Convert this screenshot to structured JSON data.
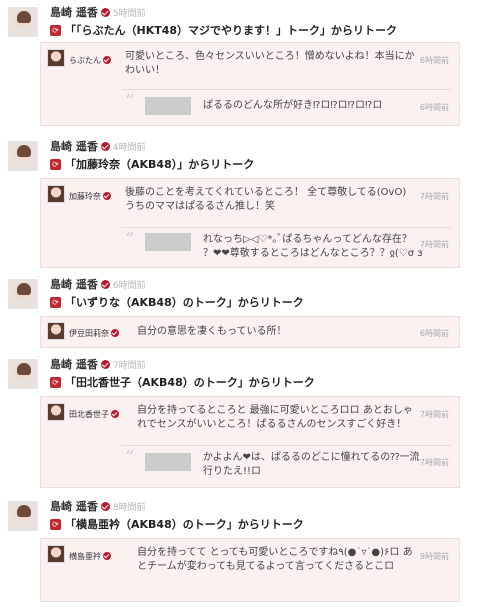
{
  "posts": [
    {
      "author": "島崎 遥香",
      "time": "5時間前",
      "retalk_title": "「「らぶたん（HKT48）マジでやります！」トーク」からリトーク",
      "talk_name": "らぶたん",
      "talk_text_1": "可愛いところ、色々センスいいところ！憎めないよね！本当にか",
      "talk_text_2": "わいい！",
      "talk_time": "6時間前",
      "quote_text": "ぱるるのどんな所が好き⁉︎ロ⁉︎ロ⁉︎ロ⁉︎ロ",
      "quote_time": "6時間前"
    },
    {
      "author": "島崎 遥香",
      "time": "4時間前",
      "retalk_title": "「加藤玲奈（AKB48）」からリトーク",
      "talk_name": "加藤玲奈",
      "talk_text_1": "後藤のことを考えてくれているところ！ 全て尊敬してる(OvO)",
      "talk_text_2": "うちのママはぱるるさん推し！笑",
      "talk_time": "7時間前",
      "quote_text_1": "れなっち▷◁♡*｡ﾟぱるちゃんってどんな存在？",
      "quote_text_2": "？❤❤尊敬するところはどんなところ？？ჲ(♡σ з",
      "quote_time": "7時間前"
    },
    {
      "author": "島崎 遥香",
      "time": "6時間前",
      "retalk_title": "「いずりな（AKB48）のトーク」からリトーク",
      "talk_name": "伊豆田莉奈",
      "talk_text": "自分の意思を凄くもっている所！",
      "talk_time": "6時間前"
    },
    {
      "author": "島崎 遥香",
      "time": "7時間前",
      "retalk_title": "「田北香世子（AKB48）のトーク」からリトーク",
      "talk_name": "田北香世子",
      "talk_text_1": "自分を持ってるところと 最強に可愛いところロロ あとおしゃ",
      "talk_text_2": "れでセンスがいいところ！ぱるるさんのセンスすごく好き！",
      "talk_time": "7時間前",
      "quote_text_1": "かよよん❤は、ぱるるのどこに憧れてるの⁇一流",
      "quote_text_2": "行りたえ!!ロ",
      "quote_time": "7時間前"
    },
    {
      "author": "島崎 遥香",
      "time": "8時間前",
      "retalk_title": "「横島亜衿（AKB48）のトーク」からリトーク",
      "talk_name": "横島亜衿",
      "talk_text_1": "自分を持ってて とっても可愛いところですね٩(●˙▿˙●)۶ロ あ",
      "talk_text_2": "とチームが変わっても見てるよって言ってくださるとこロ",
      "talk_time": "9時間前"
    }
  ],
  "icons": {
    "retalk": "retalk-icon",
    "verified": "verified-badge-icon",
    "quote": "quote-icon"
  },
  "colors": {
    "accent": "#c1272d",
    "box_bg": "#fbf1f1",
    "redacted": "#cbcbcb"
  }
}
